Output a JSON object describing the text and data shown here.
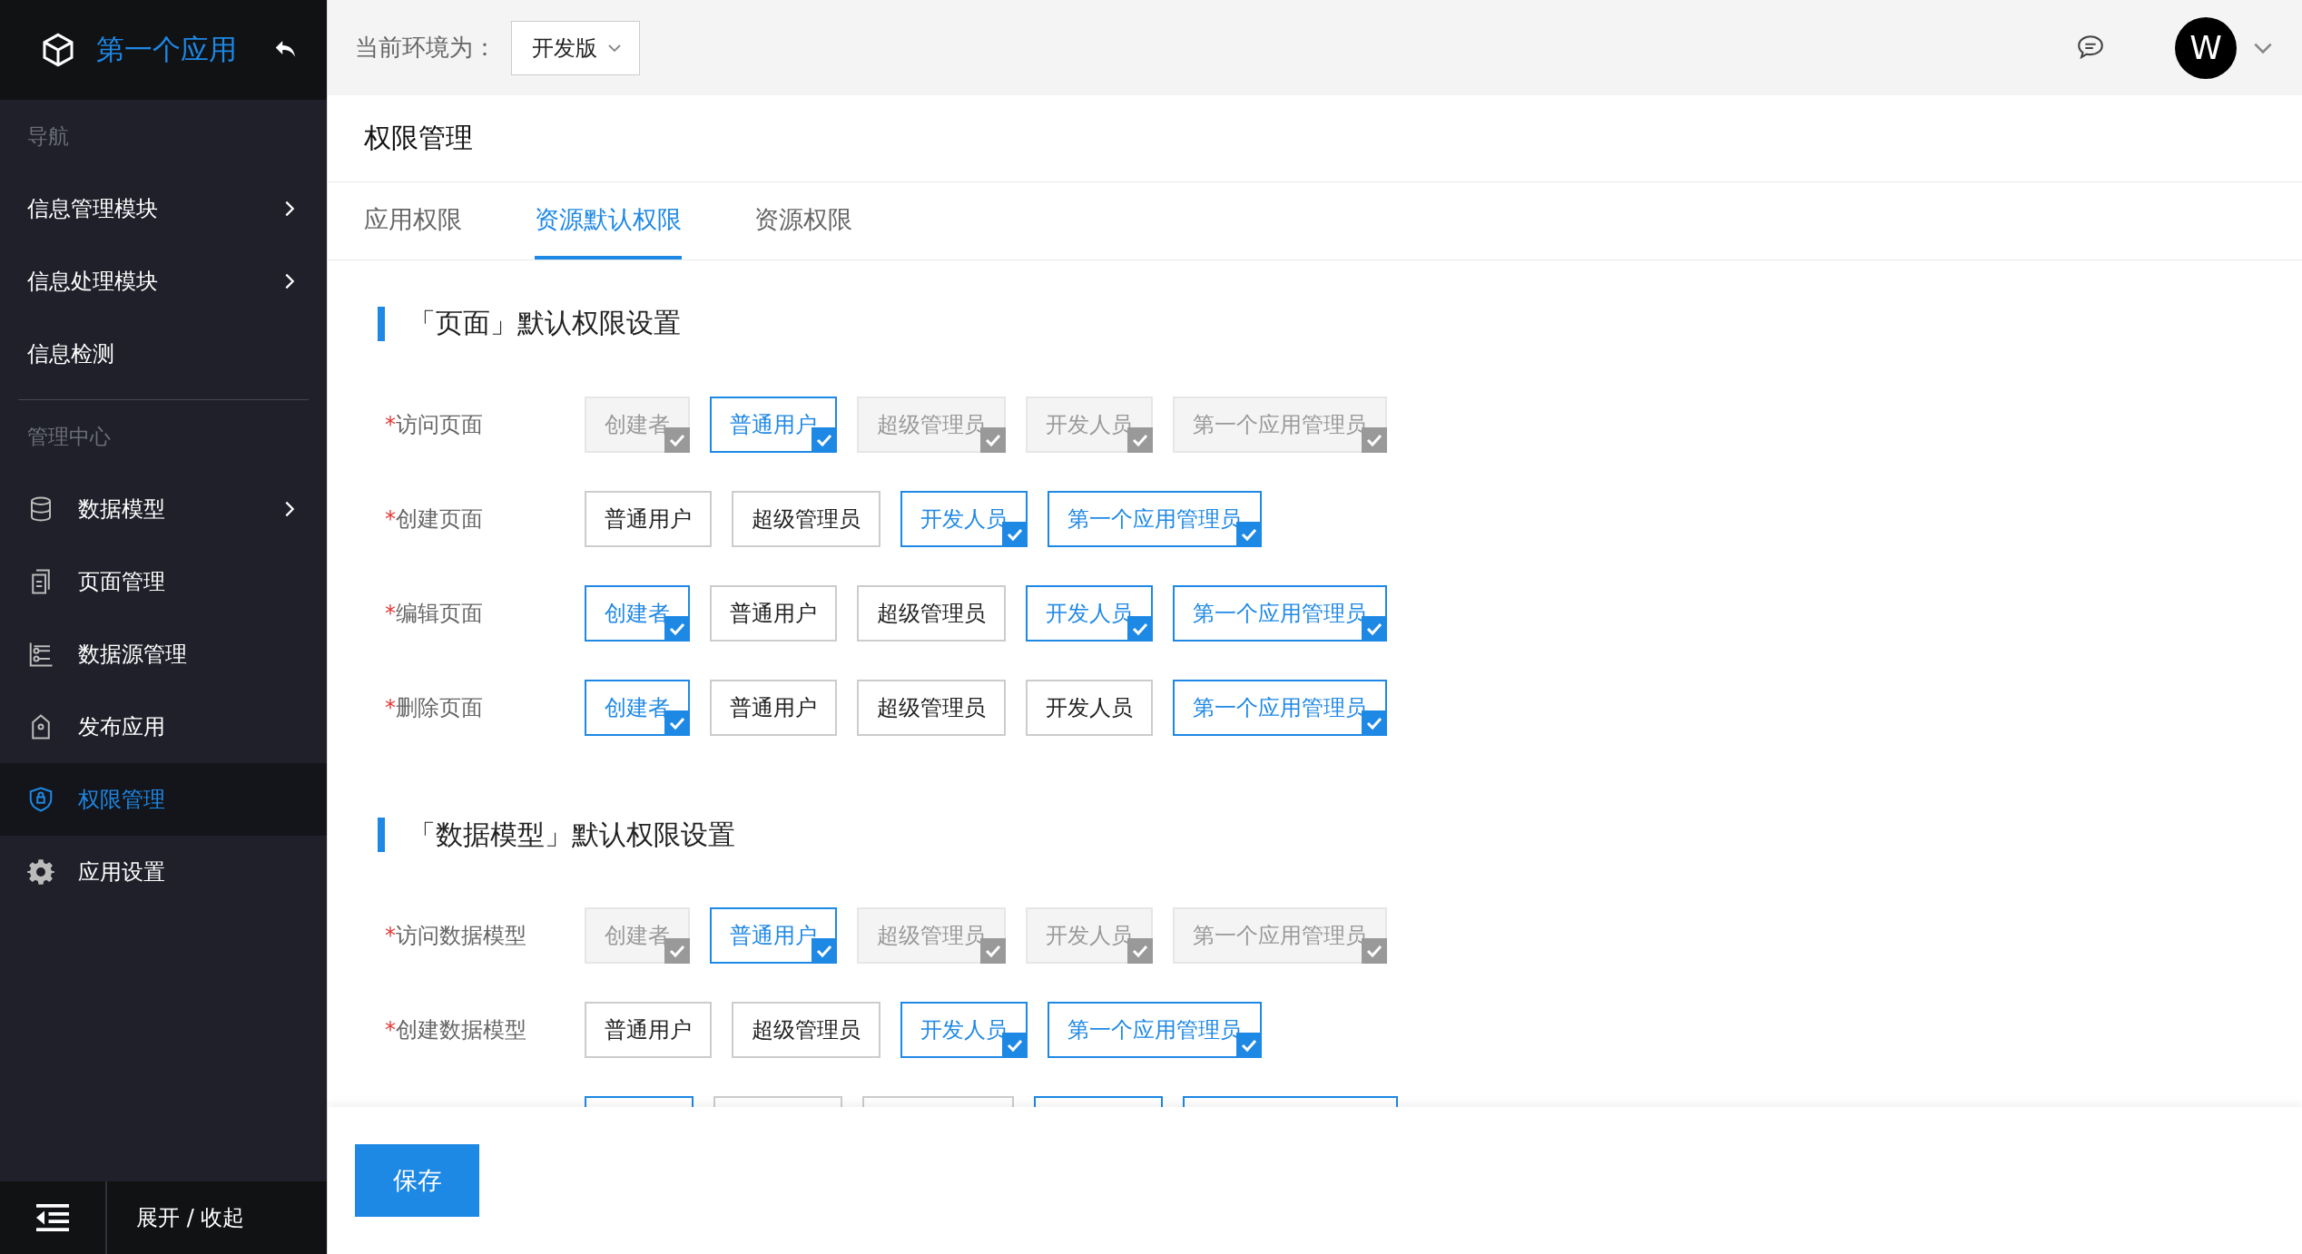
{
  "sidebar": {
    "app_title": "第一个应用",
    "groups": [
      {
        "heading": "导航",
        "items": [
          {
            "label": "信息管理模块",
            "kind": "plain",
            "has_submenu": true,
            "selected": false
          },
          {
            "label": "信息处理模块",
            "kind": "plain",
            "has_submenu": true,
            "selected": false
          },
          {
            "label": "信息检测",
            "kind": "plain",
            "has_submenu": false,
            "selected": false
          }
        ]
      },
      {
        "heading": "管理中心",
        "items": [
          {
            "label": "数据模型",
            "kind": "iconed",
            "has_submenu": true,
            "selected": false
          },
          {
            "label": "页面管理",
            "kind": "iconed",
            "has_submenu": false,
            "selected": false
          },
          {
            "label": "数据源管理",
            "kind": "iconed",
            "has_submenu": false,
            "selected": false
          },
          {
            "label": "发布应用",
            "kind": "iconed",
            "has_submenu": false,
            "selected": false
          },
          {
            "label": "权限管理",
            "kind": "iconed",
            "has_submenu": false,
            "selected": true
          },
          {
            "label": "应用设置",
            "kind": "iconed",
            "has_submenu": false,
            "selected": false
          }
        ]
      }
    ],
    "collapse_label": "展开 / 收起"
  },
  "topbar": {
    "env_label": "当前环境为：",
    "env_value": "开发版",
    "avatar_letter": "W"
  },
  "page_title": "权限管理",
  "tabs": [
    {
      "label": "应用权限",
      "selected": false
    },
    {
      "label": "资源默认权限",
      "selected": true
    },
    {
      "label": "资源权限",
      "selected": false
    }
  ],
  "sections": [
    {
      "title": "「页面」默认权限设置",
      "rows": [
        {
          "required_mark": "*",
          "label": "访问页面",
          "options": [
            {
              "label": "创建者",
              "checked": true,
              "disabled": true
            },
            {
              "label": "普通用户",
              "checked": true,
              "disabled": false
            },
            {
              "label": "超级管理员",
              "checked": true,
              "disabled": true
            },
            {
              "label": "开发人员",
              "checked": true,
              "disabled": true
            },
            {
              "label": "第一个应用管理员",
              "checked": true,
              "disabled": true
            }
          ]
        },
        {
          "required_mark": "*",
          "label": "创建页面",
          "options": [
            {
              "label": "普通用户",
              "checked": false,
              "disabled": false
            },
            {
              "label": "超级管理员",
              "checked": false,
              "disabled": false
            },
            {
              "label": "开发人员",
              "checked": true,
              "disabled": false
            },
            {
              "label": "第一个应用管理员",
              "checked": true,
              "disabled": false
            }
          ]
        },
        {
          "required_mark": "*",
          "label": "编辑页面",
          "options": [
            {
              "label": "创建者",
              "checked": true,
              "disabled": false
            },
            {
              "label": "普通用户",
              "checked": false,
              "disabled": false
            },
            {
              "label": "超级管理员",
              "checked": false,
              "disabled": false
            },
            {
              "label": "开发人员",
              "checked": true,
              "disabled": false
            },
            {
              "label": "第一个应用管理员",
              "checked": true,
              "disabled": false
            }
          ]
        },
        {
          "required_mark": "*",
          "label": "删除页面",
          "options": [
            {
              "label": "创建者",
              "checked": true,
              "disabled": false
            },
            {
              "label": "普通用户",
              "checked": false,
              "disabled": false
            },
            {
              "label": "超级管理员",
              "checked": false,
              "disabled": false
            },
            {
              "label": "开发人员",
              "checked": false,
              "disabled": false
            },
            {
              "label": "第一个应用管理员",
              "checked": true,
              "disabled": false
            }
          ]
        }
      ]
    },
    {
      "title": "「数据模型」默认权限设置",
      "rows": [
        {
          "required_mark": "*",
          "label": "访问数据模型",
          "options": [
            {
              "label": "创建者",
              "checked": true,
              "disabled": true
            },
            {
              "label": "普通用户",
              "checked": true,
              "disabled": false
            },
            {
              "label": "超级管理员",
              "checked": true,
              "disabled": true
            },
            {
              "label": "开发人员",
              "checked": true,
              "disabled": true
            },
            {
              "label": "第一个应用管理员",
              "checked": true,
              "disabled": true
            }
          ]
        },
        {
          "required_mark": "*",
          "label": "创建数据模型",
          "options": [
            {
              "label": "普通用户",
              "checked": false,
              "disabled": false
            },
            {
              "label": "超级管理员",
              "checked": false,
              "disabled": false
            },
            {
              "label": "开发人员",
              "checked": true,
              "disabled": false
            },
            {
              "label": "第一个应用管理员",
              "checked": true,
              "disabled": false
            }
          ]
        }
      ],
      "cut_off_options": [
        {
          "checked": true
        },
        {
          "checked": false
        },
        {
          "checked": false
        },
        {
          "checked": true
        },
        {
          "checked": true
        }
      ]
    }
  ],
  "save_button": "保存"
}
